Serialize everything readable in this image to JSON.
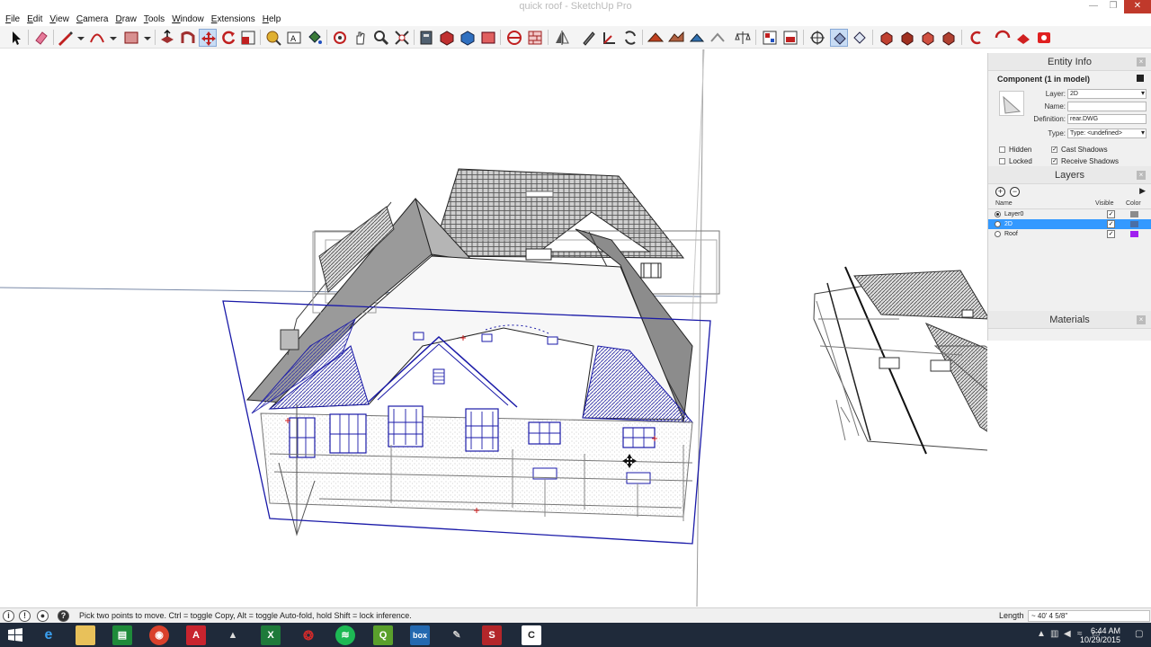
{
  "window": {
    "title": "quick roof - SketchUp Pro",
    "min_glyph": "—",
    "max_glyph": "❐",
    "close_glyph": "✕"
  },
  "menu": [
    "File",
    "Edit",
    "View",
    "Camera",
    "Draw",
    "Tools",
    "Window",
    "Extensions",
    "Help"
  ],
  "toolbar_icons": [
    "select-icon",
    "eraser-icon",
    "pencil-line-icon",
    "arc-icon",
    "rectangle-icon",
    "push-pull-icon",
    "follow-me-icon",
    "move-icon",
    "rotate-icon",
    "scale-icon",
    "tape-measure-icon",
    "text-icon",
    "paint-bucket-icon",
    "orbit-icon",
    "pan-icon",
    "zoom-icon",
    "zoom-extents-icon",
    "3d-warehouse-icon",
    "extension-warehouse-icon",
    "section-plane-icon",
    "walk-icon",
    "layout-icon",
    "axes-icon",
    "sandbox-icon"
  ],
  "entity_info": {
    "header": "Entity Info",
    "subheader": "Component (1 in model)",
    "fields": {
      "layer_label": "Layer:",
      "layer_value": "2D",
      "name_label": "Name:",
      "name_value": "",
      "definition_label": "Definition:",
      "definition_value": "rear.DWG",
      "type_label": "Type:",
      "type_value": "Type: <undefined>"
    },
    "checks": {
      "hidden": "Hidden",
      "locked": "Locked",
      "cast_shadows": "Cast Shadows",
      "receive_shadows": "Receive Shadows"
    },
    "checked_glyph": "✓"
  },
  "layers": {
    "header": "Layers",
    "columns": {
      "name": "Name",
      "visible": "Visible",
      "color": "Color"
    },
    "rows": [
      {
        "name": "Layer0",
        "active": true,
        "visible": true,
        "color": "#8c8c8c",
        "selected": false
      },
      {
        "name": "2D",
        "active": false,
        "visible": true,
        "color": "#4a6fa5",
        "selected": true
      },
      {
        "name": "Roof",
        "active": false,
        "visible": true,
        "color": "#a020f0",
        "selected": false
      }
    ]
  },
  "materials": {
    "header": "Materials"
  },
  "status": {
    "message": "Pick two points to move.  Ctrl = toggle Copy, Alt = toggle Auto-fold, hold Shift = lock inference.",
    "vcb_label": "Length",
    "vcb_value": "~ 40' 4 5/8\""
  },
  "taskbar": {
    "apps": [
      "windows-start-icon",
      "edge-icon",
      "file-explorer-icon",
      "excel-store-icon",
      "chrome-icon",
      "autocad-icon",
      "revit-icon",
      "excel-icon",
      "adobe-icon",
      "spotify-icon",
      "quicken-icon",
      "box-icon",
      "sketchbook-icon",
      "sketchup-icon",
      "camtasia-icon"
    ],
    "box_label": "box",
    "time": "6:44 AM",
    "date": "10/29/2015"
  },
  "colors": {
    "selection_blue": "#1a1aa8",
    "titlebar_close": "#c0392b",
    "layer_selected": "#3399ff",
    "taskbar_bg": "#1f2a3a"
  }
}
